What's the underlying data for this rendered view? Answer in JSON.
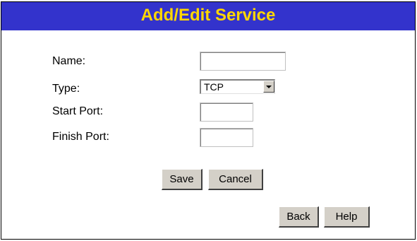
{
  "header": {
    "title": "Add/Edit Service"
  },
  "form": {
    "name_label": "Name:",
    "name_value": "",
    "type_label": "Type:",
    "type_value": "TCP",
    "start_port_label": "Start Port:",
    "start_port_value": "",
    "finish_port_label": "Finish Port:",
    "finish_port_value": ""
  },
  "buttons": {
    "save": "Save",
    "cancel": "Cancel",
    "back": "Back",
    "help": "Help"
  },
  "colors": {
    "title_bar": "#3333cc",
    "title_text": "#ffd700"
  }
}
